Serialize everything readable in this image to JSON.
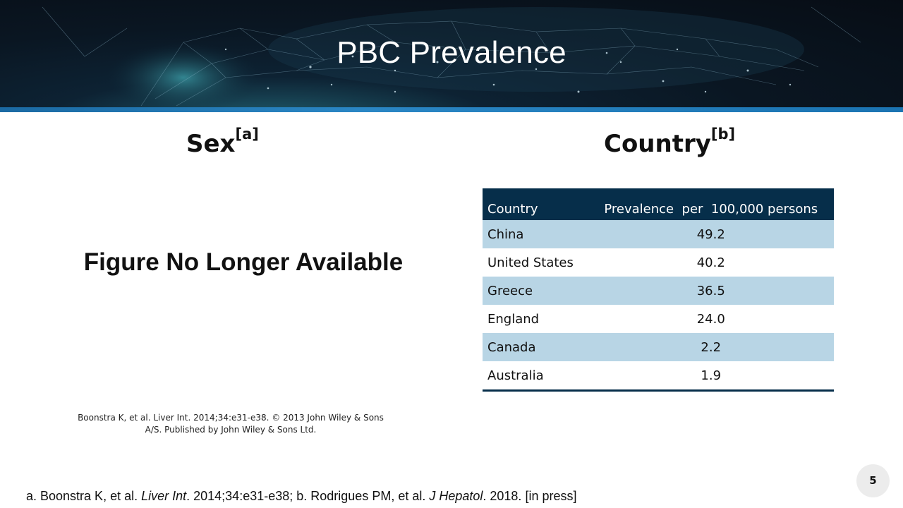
{
  "slide": {
    "title": "PBC Prevalence",
    "page_number": "5"
  },
  "sex_section": {
    "heading": "Sex",
    "heading_ref": "[a]",
    "placeholder": "Figure No Longer Available",
    "caption_line1": "Boonstra K, et al. Liver Int. 2014;34:e31-e38. © 2013 John Wiley & Sons",
    "caption_line2": "A/S. Published by John Wiley & Sons Ltd."
  },
  "country_section": {
    "heading": "Country",
    "heading_ref": "[b]",
    "table": {
      "headers": [
        "Country",
        "Prevalence  per  100,000 persons"
      ],
      "rows": [
        {
          "country": "China",
          "value": "49.2"
        },
        {
          "country": "United States",
          "value": "40.2"
        },
        {
          "country": "Greece",
          "value": "36.5"
        },
        {
          "country": "England",
          "value": "24.0"
        },
        {
          "country": "Canada",
          "value": "2.2"
        },
        {
          "country": "Australia",
          "value": "1.9"
        }
      ]
    }
  },
  "footnote": {
    "a_prefix": "a. Boonstra K, et al. ",
    "a_journal": "Liver Int",
    "a_rest": ". 2014;34:e31-e38; b. Rodrigues PM, et al. ",
    "b_journal": "J Hepatol",
    "b_rest": ". 2018. [in press]"
  },
  "colors": {
    "banner_dark": "#0a1622",
    "banner_accent_line": "#1b6aa3",
    "table_header": "#062e4a",
    "table_band": "#b8d5e5"
  }
}
